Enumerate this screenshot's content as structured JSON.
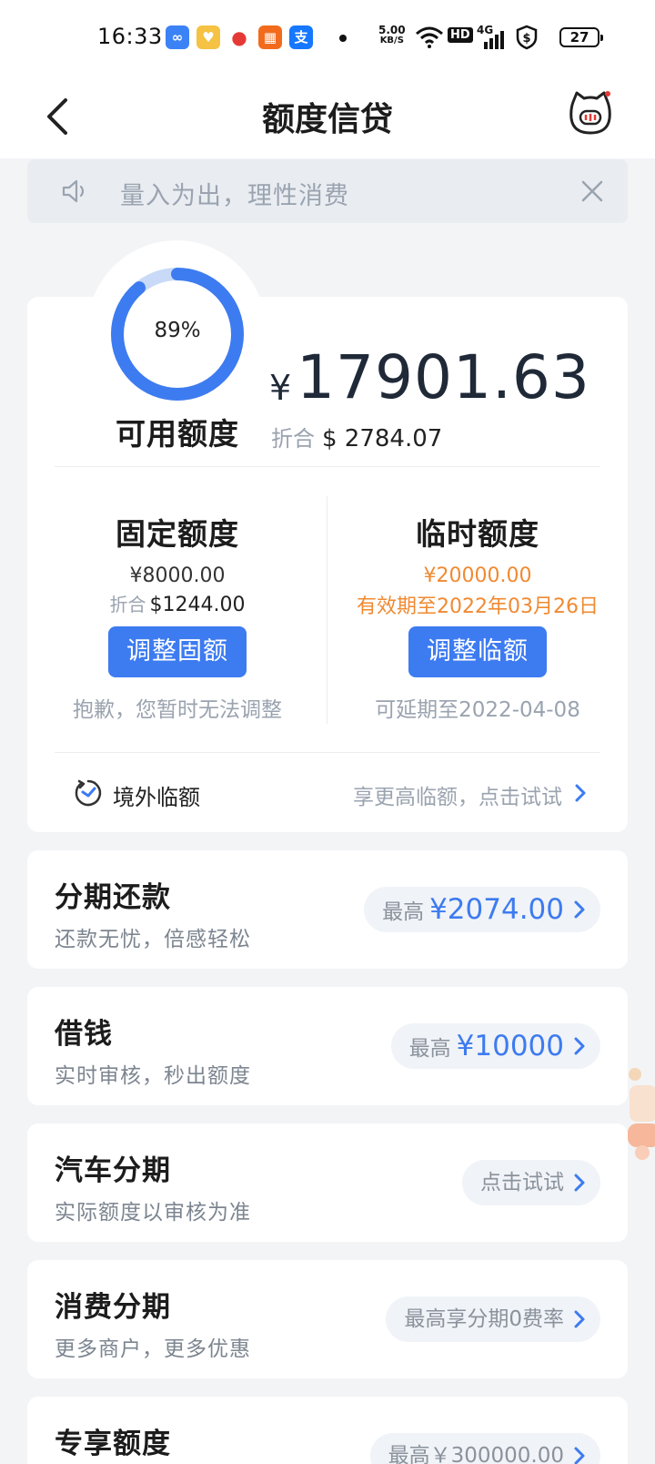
{
  "status_bar": {
    "time": "16:33",
    "net_speed_value": "5.00",
    "net_speed_unit": "KB/S",
    "hd_label": "HD",
    "signal_label": "4G",
    "battery": "27"
  },
  "nav": {
    "title": "额度信贷"
  },
  "notice": {
    "text": "量入为出，理性消费"
  },
  "quota": {
    "percent_label": "89%",
    "percent_value": 0.89,
    "available_label": "可用额度",
    "currency_symbol": "¥",
    "available_amount": "17901.63",
    "converted_prefix": "折合",
    "converted_amount": "$ 2784.07",
    "fixed": {
      "title": "固定额度",
      "amount": "¥8000.00",
      "converted_prefix": "折合",
      "converted_amount": "$1244.00",
      "button_label": "调整固额",
      "note": "抱歉，您暂时无法调整"
    },
    "temp": {
      "title": "临时额度",
      "amount": "¥20000.00",
      "valid_until": "有效期至2022年03月26日",
      "button_label": "调整临额",
      "note": "可延期至2022-04-08"
    },
    "overseas": {
      "label": "境外临额",
      "hint": "享更高临额，点击试试"
    }
  },
  "products": [
    {
      "title": "分期还款",
      "subtitle": "还款无忧，倍感轻松",
      "pill_prefix": "最高",
      "pill_amount": "¥2074.00"
    },
    {
      "title": "借钱",
      "subtitle": "实时审核，秒出额度",
      "pill_prefix": "最高",
      "pill_amount": "¥10000"
    },
    {
      "title": "汽车分期",
      "subtitle": "实际额度以审核为准",
      "pill_text": "点击试试"
    },
    {
      "title": "消费分期",
      "subtitle": "更多商户，更多优惠",
      "pill_text": "最高享分期0费率"
    },
    {
      "title": "专享额度",
      "pill_text": "最高￥300000.00"
    }
  ],
  "colors": {
    "accent": "#3d7bf0",
    "ring_track": "#c9daf8",
    "warning": "#f08a32",
    "background": "#f3f4f6"
  },
  "icons": [
    "back-icon",
    "mascot-icon",
    "speaker-icon",
    "close-icon",
    "timer-icon",
    "chevron-right-icon"
  ]
}
